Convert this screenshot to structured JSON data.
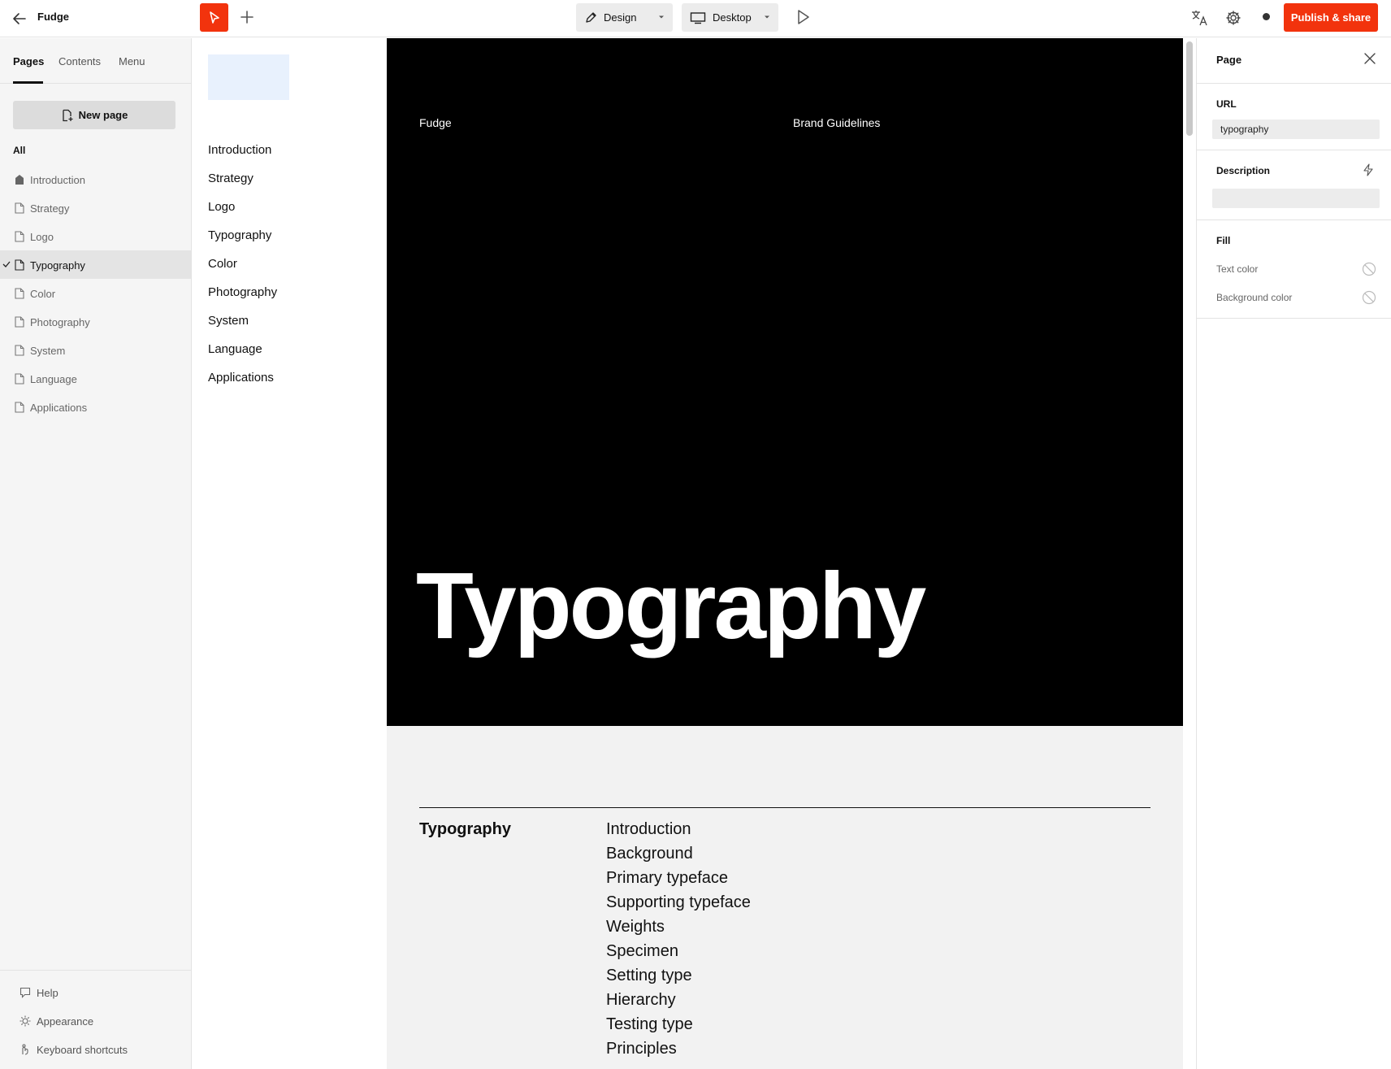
{
  "app": {
    "title": "Fudge"
  },
  "toolbar": {
    "mode_label": "Design",
    "device_label": "Desktop",
    "publish_label": "Publish & share"
  },
  "sidebar": {
    "tabs": [
      {
        "label": "Pages"
      },
      {
        "label": "Contents"
      },
      {
        "label": "Menu"
      }
    ],
    "new_page_label": "New page",
    "filter_label": "All",
    "pages": [
      {
        "label": "Introduction",
        "icon": "home-page-icon"
      },
      {
        "label": "Strategy",
        "icon": "page-icon"
      },
      {
        "label": "Logo",
        "icon": "page-icon"
      },
      {
        "label": "Typography",
        "icon": "page-icon",
        "selected": true
      },
      {
        "label": "Color",
        "icon": "page-icon"
      },
      {
        "label": "Photography",
        "icon": "page-icon"
      },
      {
        "label": "System",
        "icon": "page-icon"
      },
      {
        "label": "Language",
        "icon": "page-icon"
      },
      {
        "label": "Applications",
        "icon": "page-icon"
      }
    ],
    "footer": [
      {
        "label": "Help",
        "icon": "help-icon"
      },
      {
        "label": "Appearance",
        "icon": "sun-icon"
      },
      {
        "label": "Keyboard shortcuts",
        "icon": "keyboard-icon"
      }
    ]
  },
  "site_nav": {
    "items": [
      "Introduction",
      "Strategy",
      "Logo",
      "Typography",
      "Color",
      "Photography",
      "System",
      "Language",
      "Applications"
    ]
  },
  "canvas": {
    "brand": "Fudge",
    "subtitle": "Brand Guidelines",
    "hero_title": "Typography",
    "section_title": "Typography",
    "toc": [
      "Introduction",
      "Background",
      "Primary typeface",
      "Supporting typeface",
      "Weights",
      "Specimen",
      "Setting type",
      "Hierarchy",
      "Testing type",
      "Principles"
    ]
  },
  "right_panel": {
    "title": "Page",
    "url_label": "URL",
    "url_value": "typography",
    "description_label": "Description",
    "description_value": "",
    "fill_label": "Fill",
    "text_color_label": "Text color",
    "background_color_label": "Background color"
  },
  "colors": {
    "accent": "#f2330d",
    "hero_bg": "#000000",
    "canvas_bg": "#f2f2f2"
  }
}
